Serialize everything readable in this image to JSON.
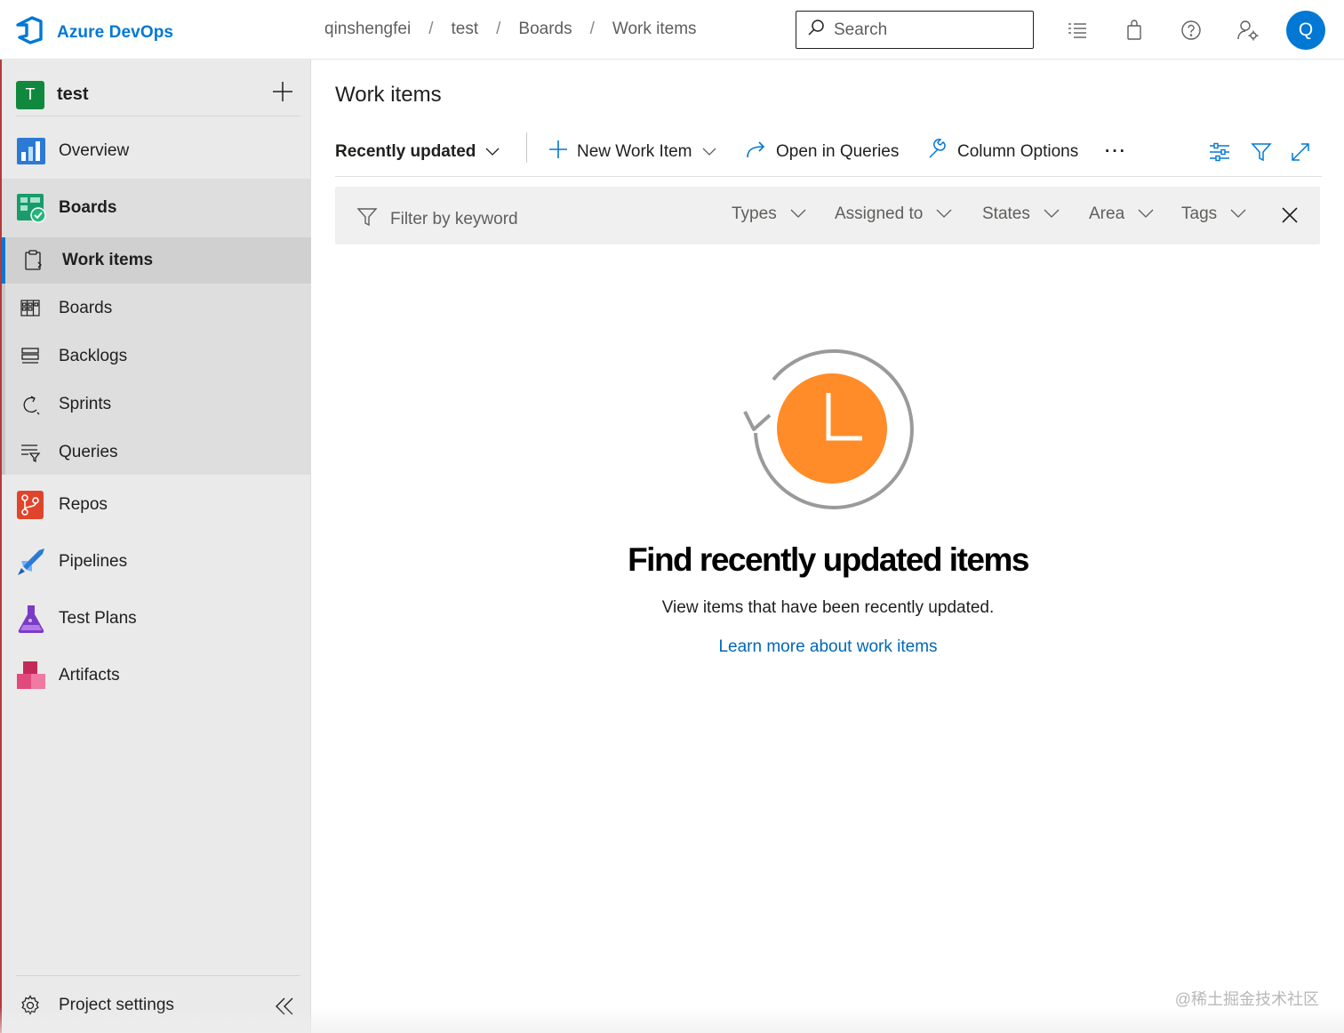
{
  "header": {
    "brand": "Azure DevOps",
    "breadcrumbs": [
      "qinshengfei",
      "test",
      "Boards",
      "Work items"
    ],
    "search_placeholder": "Search",
    "avatar_initial": "Q"
  },
  "sidebar": {
    "project": {
      "initial": "T",
      "name": "test"
    },
    "items": [
      {
        "label": "Overview"
      },
      {
        "label": "Boards"
      },
      {
        "label": "Repos"
      },
      {
        "label": "Pipelines"
      },
      {
        "label": "Test Plans"
      },
      {
        "label": "Artifacts"
      }
    ],
    "boards_sub": [
      {
        "label": "Work items"
      },
      {
        "label": "Boards"
      },
      {
        "label": "Backlogs"
      },
      {
        "label": "Sprints"
      },
      {
        "label": "Queries"
      }
    ],
    "settings_label": "Project settings"
  },
  "main": {
    "title": "Work items",
    "toolbar": {
      "view": "Recently updated",
      "new_item": "New Work Item",
      "open_queries": "Open in Queries",
      "column_options": "Column Options",
      "more": "···"
    },
    "filter": {
      "placeholder": "Filter by keyword",
      "types": "Types",
      "assigned": "Assigned to",
      "states": "States",
      "area": "Area",
      "tags": "Tags"
    },
    "empty": {
      "title": "Find recently updated items",
      "subtitle": "View items that have been recently updated.",
      "link": "Learn more about work items"
    }
  },
  "watermark": "@稀土掘金技术社区",
  "colors": {
    "accent": "#0078d4",
    "clock": "#ff8c28",
    "link": "#0067b8"
  }
}
